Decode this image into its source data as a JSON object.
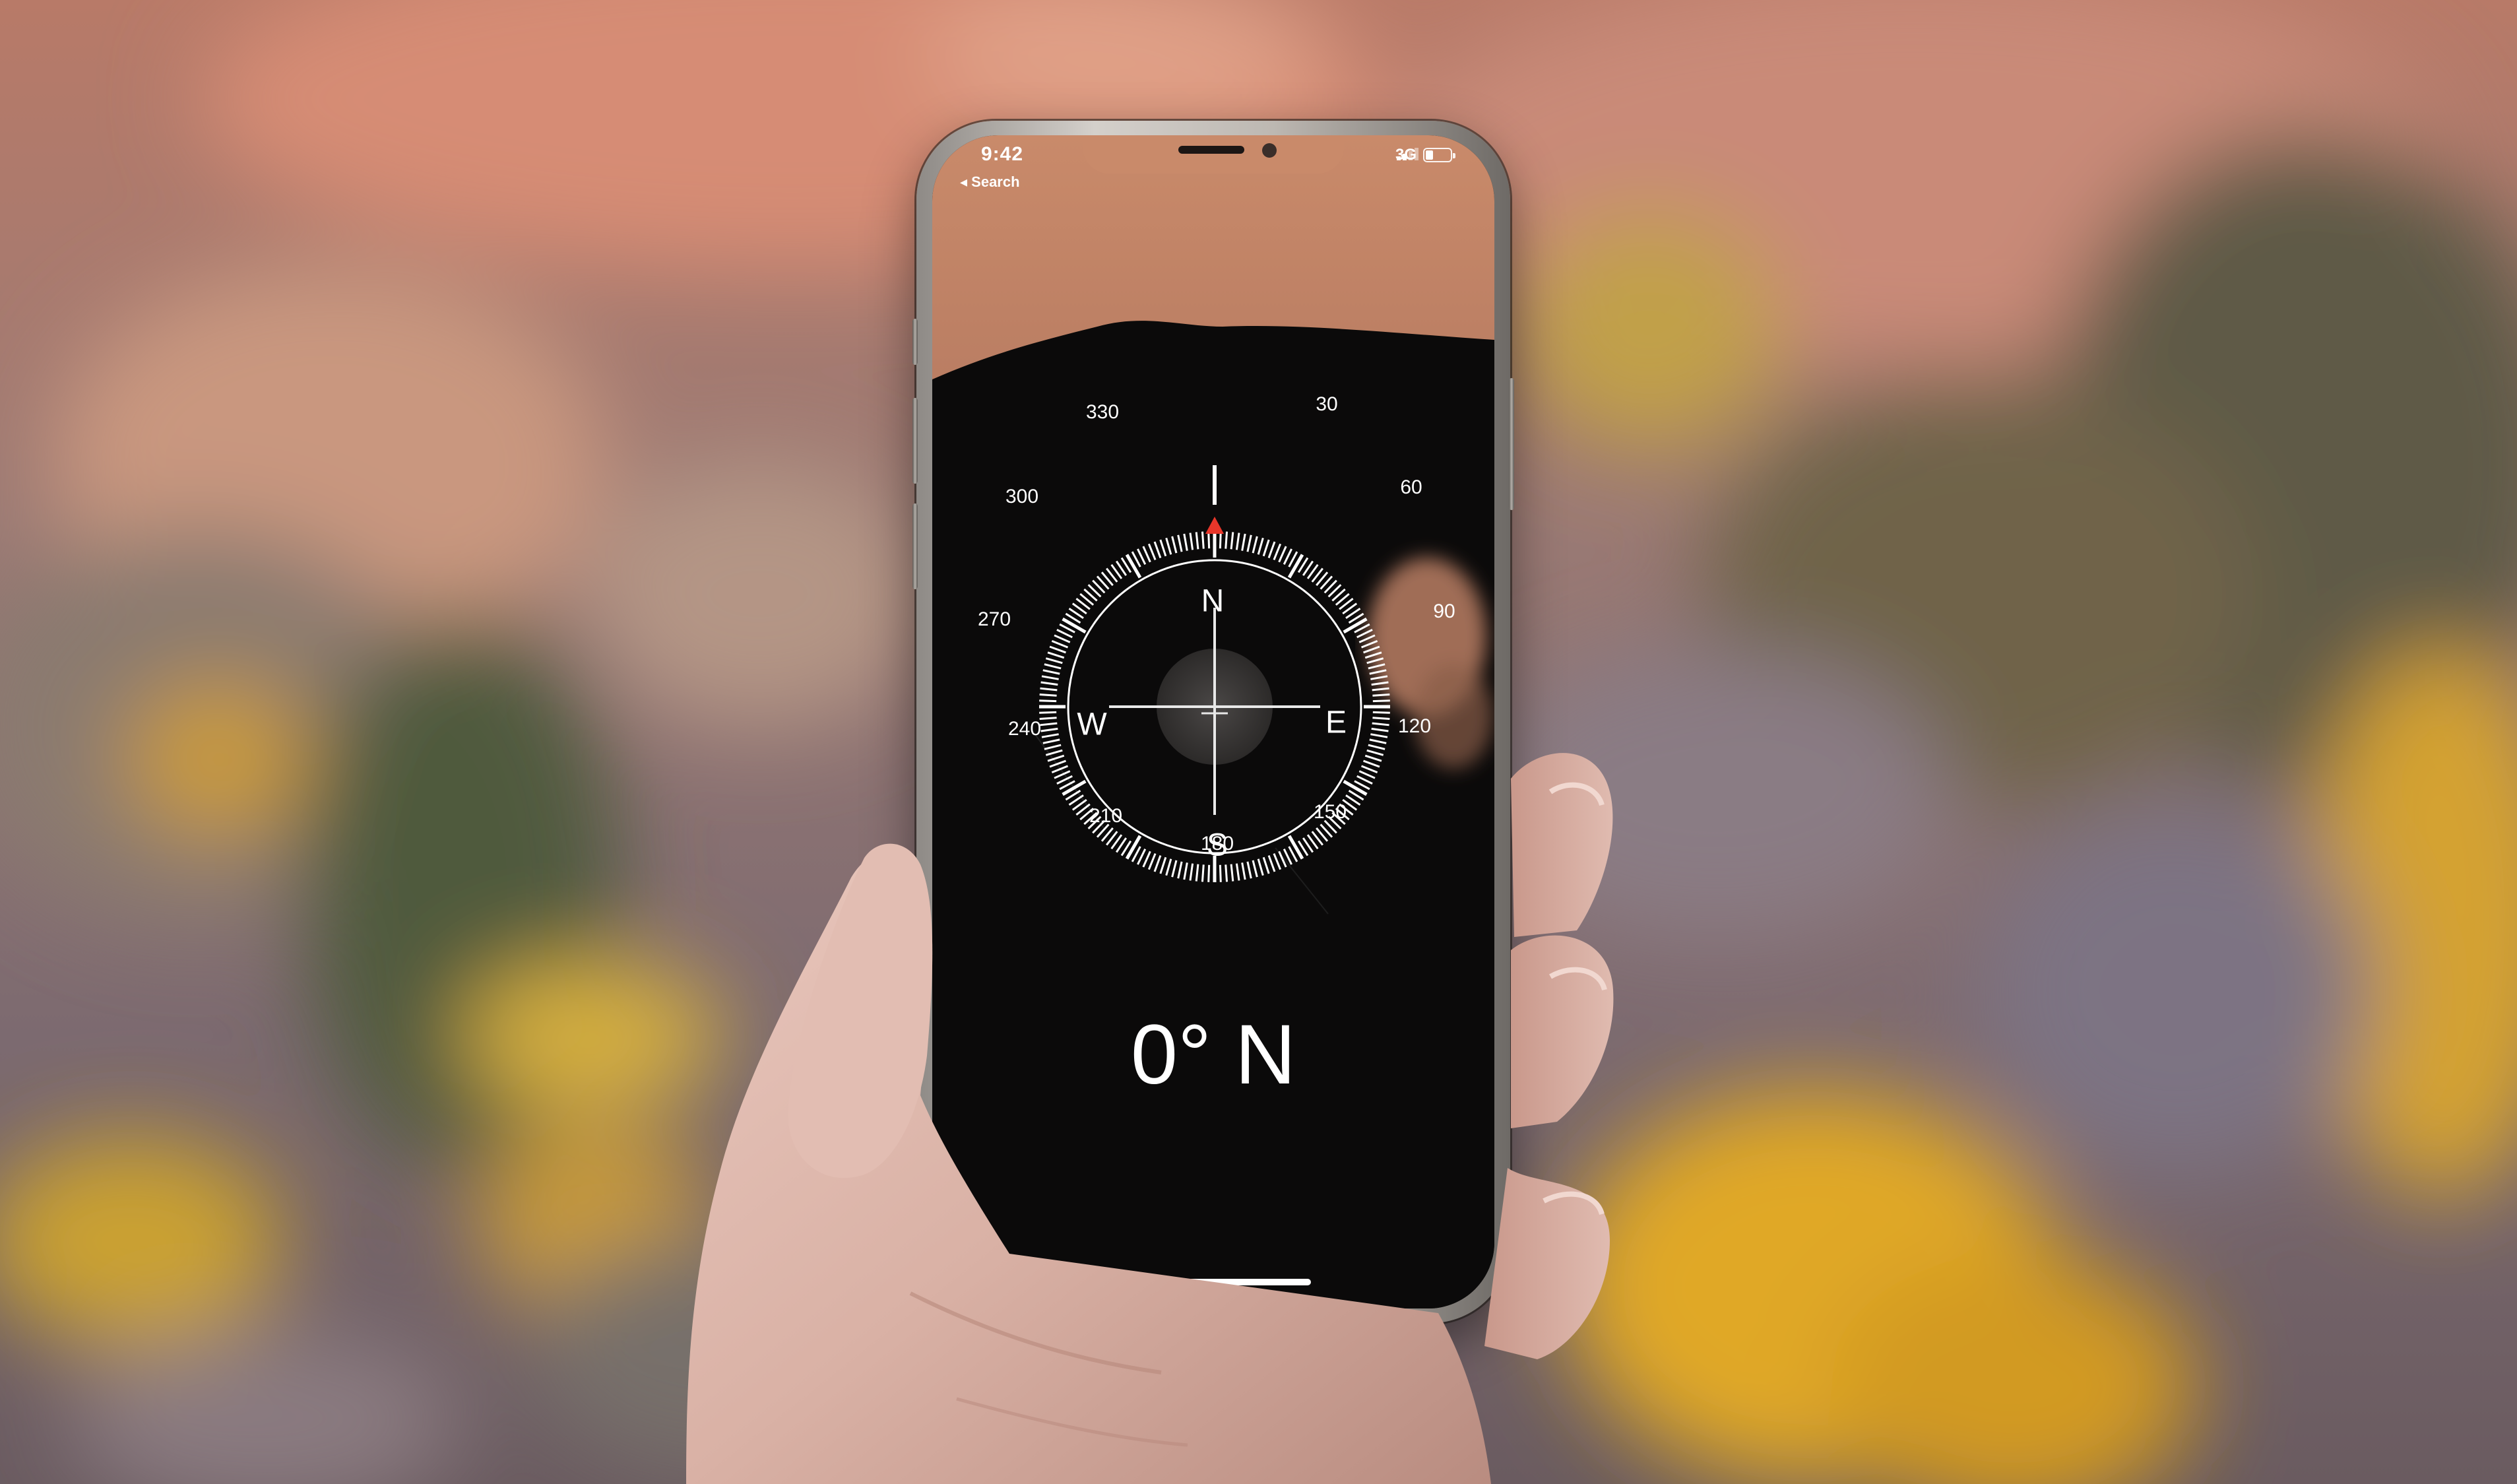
{
  "status_bar": {
    "time": "9:42",
    "back_label": "◂ Search",
    "network": "3G",
    "battery_level": 0.3
  },
  "compass": {
    "heading_value": "0°",
    "heading_direction": "N",
    "cardinals": {
      "north": "N",
      "east": "E",
      "south": "S",
      "west": "W"
    },
    "degrees": {
      "d30": "30",
      "d60": "60",
      "d90": "90",
      "d120": "120",
      "d150": "150",
      "d180": "180",
      "d210": "210",
      "d240": "240",
      "d270": "270",
      "d300": "300",
      "d330": "330"
    },
    "needle_color": "#e8362a"
  },
  "colors": {
    "screen_background": "#0b0a0a",
    "dial_color": "#ffffff",
    "background_warm": "#c77c63",
    "background_foliage": "#d6a531"
  },
  "icons": {
    "location": "location-arrow-icon",
    "signal": "cellular-signal-icon",
    "battery": "battery-icon"
  }
}
